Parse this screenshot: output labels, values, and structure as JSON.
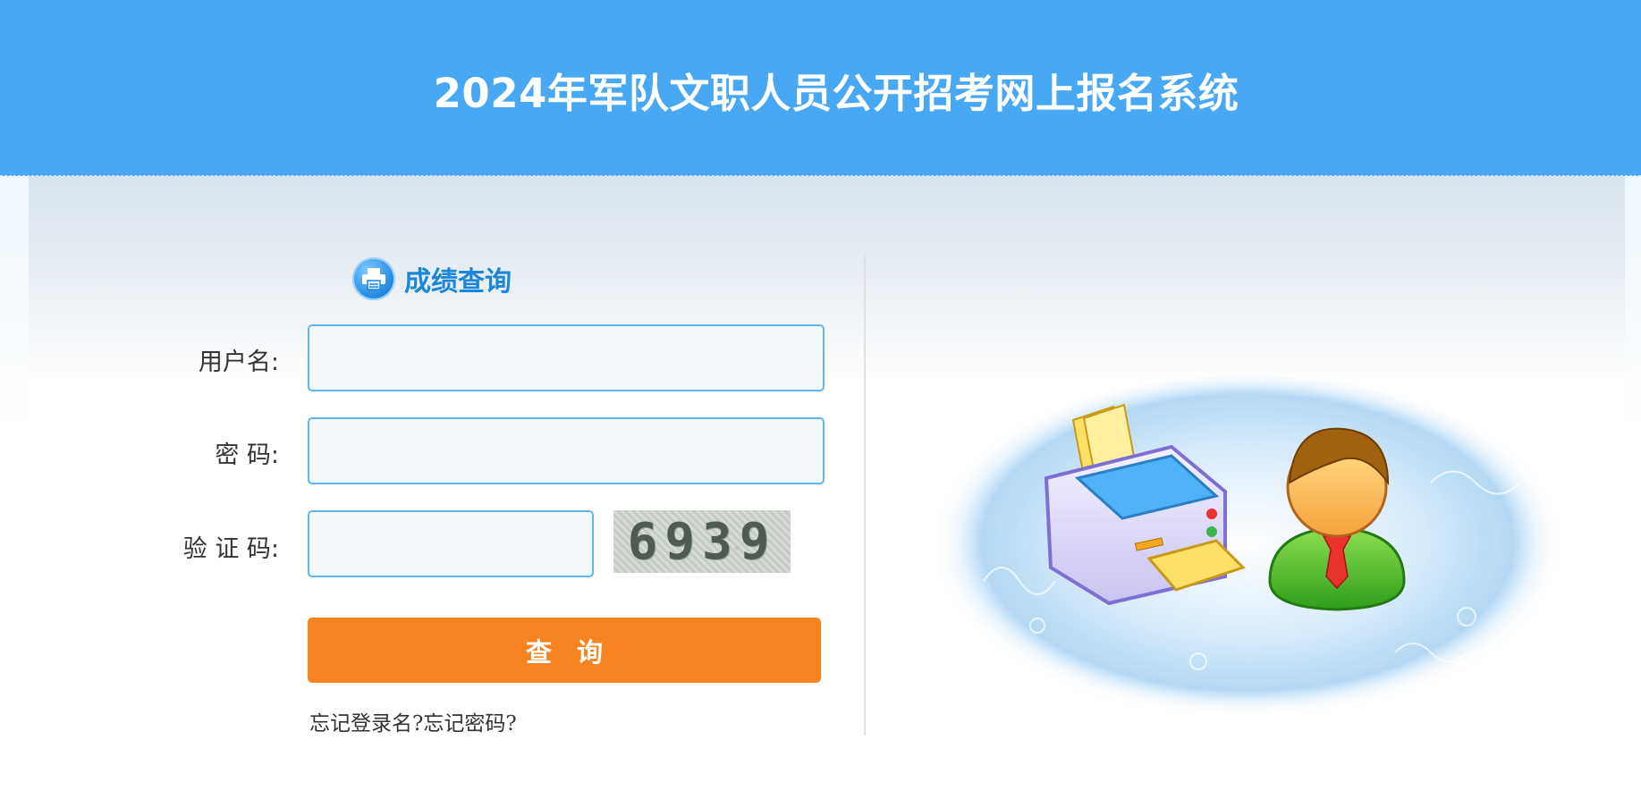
{
  "header": {
    "title": "2024年军队文职人员公开招考网上报名系统"
  },
  "form": {
    "title": "成绩查询",
    "title_icon": "printer-icon",
    "username_label": "用户名:",
    "username_value": "",
    "password_label": "密 码:",
    "password_value": "",
    "captcha_label": "验 证 码:",
    "captcha_value": "",
    "captcha_image_text": "6939",
    "submit_label": "查询",
    "forgot_username": "忘记登录名?",
    "forgot_password": "忘记密码?"
  },
  "colors": {
    "header_bg": "#48a8f3",
    "title_accent": "#1c86d8",
    "button_bg": "#f78420",
    "input_border": "#64b3eb"
  },
  "illustration": {
    "icon": "printer-user-illustration"
  }
}
